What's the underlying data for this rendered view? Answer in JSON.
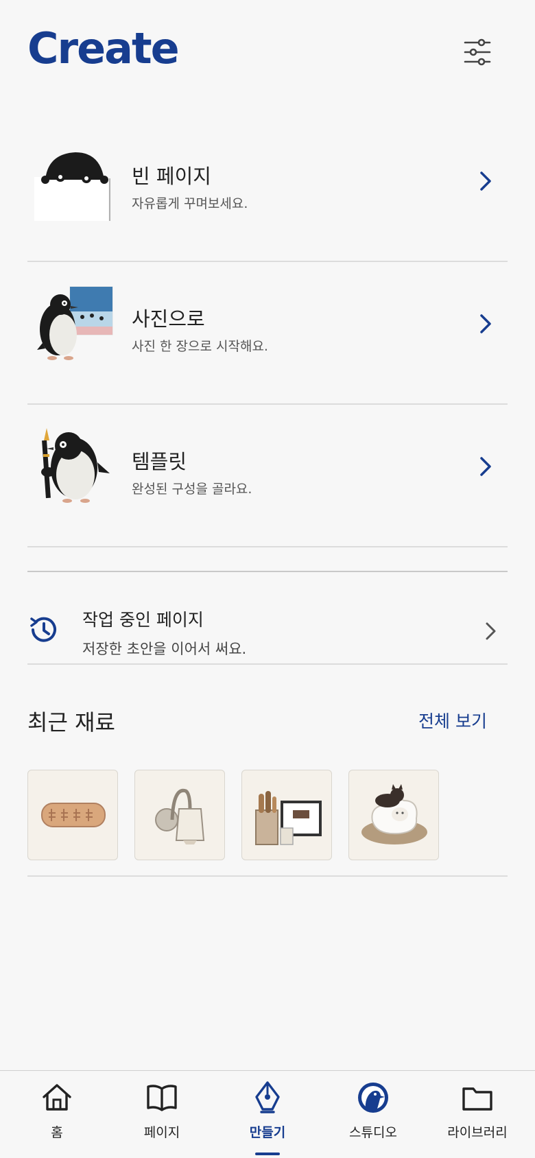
{
  "header": {
    "title": "Create",
    "filter_icon": "sliders-icon"
  },
  "menu": [
    {
      "label": "빈 페이지",
      "sub": "자유롭게 꾸며보세요.",
      "illustration": "penguin-peeking-over-paper"
    },
    {
      "label": "사진으로",
      "sub": "사진 한 장으로 시작해요.",
      "illustration": "penguin-with-photo"
    },
    {
      "label": "템플릿",
      "sub": "완성된 구성을 골라요.",
      "illustration": "penguin-with-fountain-pen"
    }
  ],
  "draft": {
    "label": "작업 중인 페이지",
    "sub": "저장한 초안을 이어서 써요.",
    "icon": "history-icon"
  },
  "recent": {
    "title": "최근 재료",
    "see_all": "전체 보기",
    "items": [
      "cookie-material",
      "wall-lamp-material",
      "desk-items-material",
      "cats-on-pillow-material"
    ]
  },
  "tabs": [
    {
      "label": "홈",
      "icon": "home-icon"
    },
    {
      "label": "페이지",
      "icon": "book-icon"
    },
    {
      "label": "만들기",
      "icon": "pen-nib-icon",
      "active": true
    },
    {
      "label": "스튜디오",
      "icon": "penguin-badge-icon"
    },
    {
      "label": "라이브러리",
      "icon": "folder-icon"
    }
  ],
  "colors": {
    "accent": "#173d8f",
    "background": "#f7f7f7",
    "divider": "#dcdcdc"
  }
}
